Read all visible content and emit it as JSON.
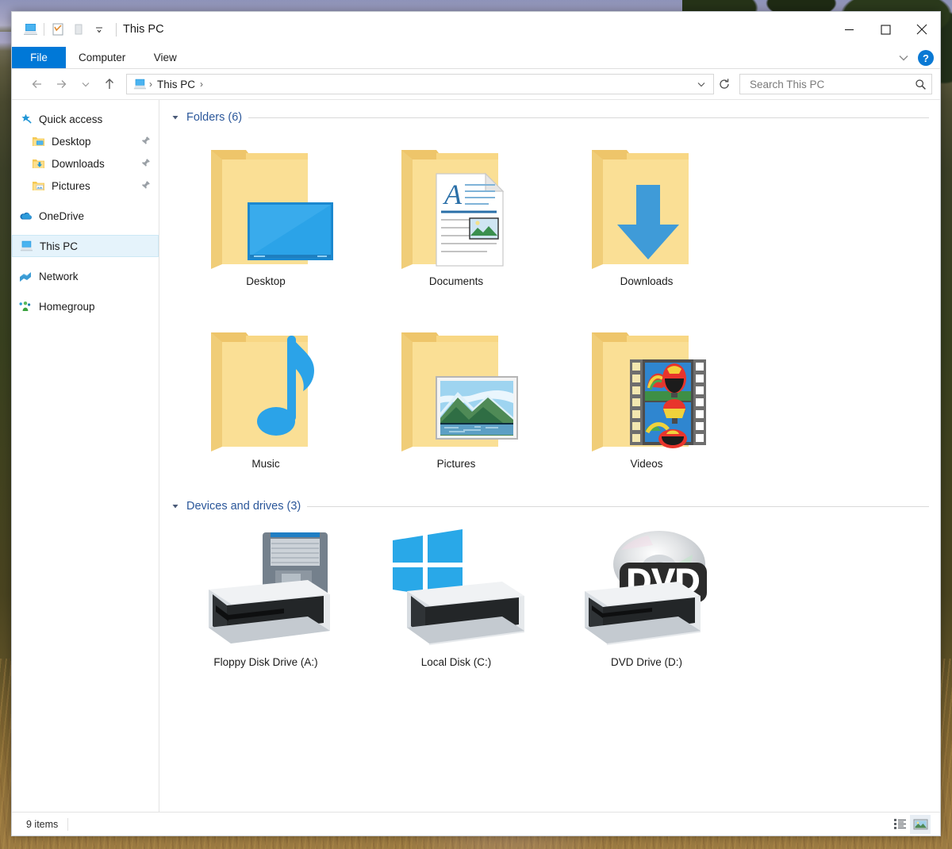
{
  "window": {
    "title": "This PC",
    "quick_access_toolbar": [
      {
        "name": "this-pc-icon",
        "label": "This PC"
      },
      {
        "name": "properties-icon",
        "label": "Properties"
      },
      {
        "name": "new-folder-icon",
        "label": "New folder"
      },
      {
        "name": "customize-dropdown-icon",
        "label": "Customize Quick Access Toolbar"
      }
    ],
    "controls": {
      "minimize": "–",
      "maximize": "□",
      "close": "✕"
    }
  },
  "ribbon": {
    "tabs": [
      {
        "label": "File",
        "active": true
      },
      {
        "label": "Computer",
        "active": false
      },
      {
        "label": "View",
        "active": false
      }
    ],
    "collapse_label": "Minimize the Ribbon",
    "help_label": "?"
  },
  "navigation": {
    "back_label": "Back",
    "forward_label": "Forward",
    "recent_label": "Recent locations",
    "up_label": "Up",
    "breadcrumb": [
      "This PC"
    ],
    "breadcrumb_separator": "›",
    "dropdown_label": "Previous locations",
    "refresh_label": "Refresh"
  },
  "search": {
    "placeholder": "Search This PC",
    "value": "",
    "icon": "search-icon"
  },
  "sidebar": {
    "items": [
      {
        "label": "Quick access",
        "icon": "star-pin-icon",
        "level": 0,
        "pinned": false,
        "selected": false
      },
      {
        "label": "Desktop",
        "icon": "folder-desktop-icon",
        "level": 1,
        "pinned": true,
        "selected": false
      },
      {
        "label": "Downloads",
        "icon": "folder-downloads-icon",
        "level": 1,
        "pinned": true,
        "selected": false
      },
      {
        "label": "Pictures",
        "icon": "folder-pictures-icon",
        "level": 1,
        "pinned": true,
        "selected": false
      },
      {
        "label": "OneDrive",
        "icon": "onedrive-cloud-icon",
        "level": 0,
        "pinned": false,
        "selected": false,
        "gap_before": true
      },
      {
        "label": "This PC",
        "icon": "this-pc-icon",
        "level": 0,
        "pinned": false,
        "selected": true,
        "gap_before": true
      },
      {
        "label": "Network",
        "icon": "network-icon",
        "level": 0,
        "pinned": false,
        "selected": false,
        "gap_before": true
      },
      {
        "label": "Homegroup",
        "icon": "homegroup-icon",
        "level": 0,
        "pinned": false,
        "selected": false,
        "gap_before": true
      }
    ]
  },
  "content": {
    "groups": [
      {
        "title": "Folders (6)",
        "expanded": true,
        "items": [
          {
            "label": "Desktop",
            "icon": "folder-desktop-icon"
          },
          {
            "label": "Documents",
            "icon": "folder-documents-icon"
          },
          {
            "label": "Downloads",
            "icon": "folder-downloads-icon"
          },
          {
            "label": "Music",
            "icon": "folder-music-icon"
          },
          {
            "label": "Pictures",
            "icon": "folder-pictures-icon"
          },
          {
            "label": "Videos",
            "icon": "folder-videos-icon"
          }
        ]
      },
      {
        "title": "Devices and drives (3)",
        "expanded": true,
        "items": [
          {
            "label": "Floppy Disk Drive (A:)",
            "icon": "floppy-drive-icon"
          },
          {
            "label": "Local Disk (C:)",
            "icon": "local-disk-icon"
          },
          {
            "label": "DVD Drive (D:)",
            "icon": "dvd-drive-icon"
          }
        ]
      }
    ]
  },
  "statusbar": {
    "item_count": "9 items",
    "views": [
      {
        "name": "details-view-button",
        "label": "Details view",
        "active": false
      },
      {
        "name": "large-icons-view-button",
        "label": "Large icons view",
        "active": true
      }
    ]
  },
  "colors": {
    "accent": "#0078d7",
    "group_title": "#2b579a",
    "selected_row": "#e5f3fb",
    "folder": "#f7d98b"
  }
}
